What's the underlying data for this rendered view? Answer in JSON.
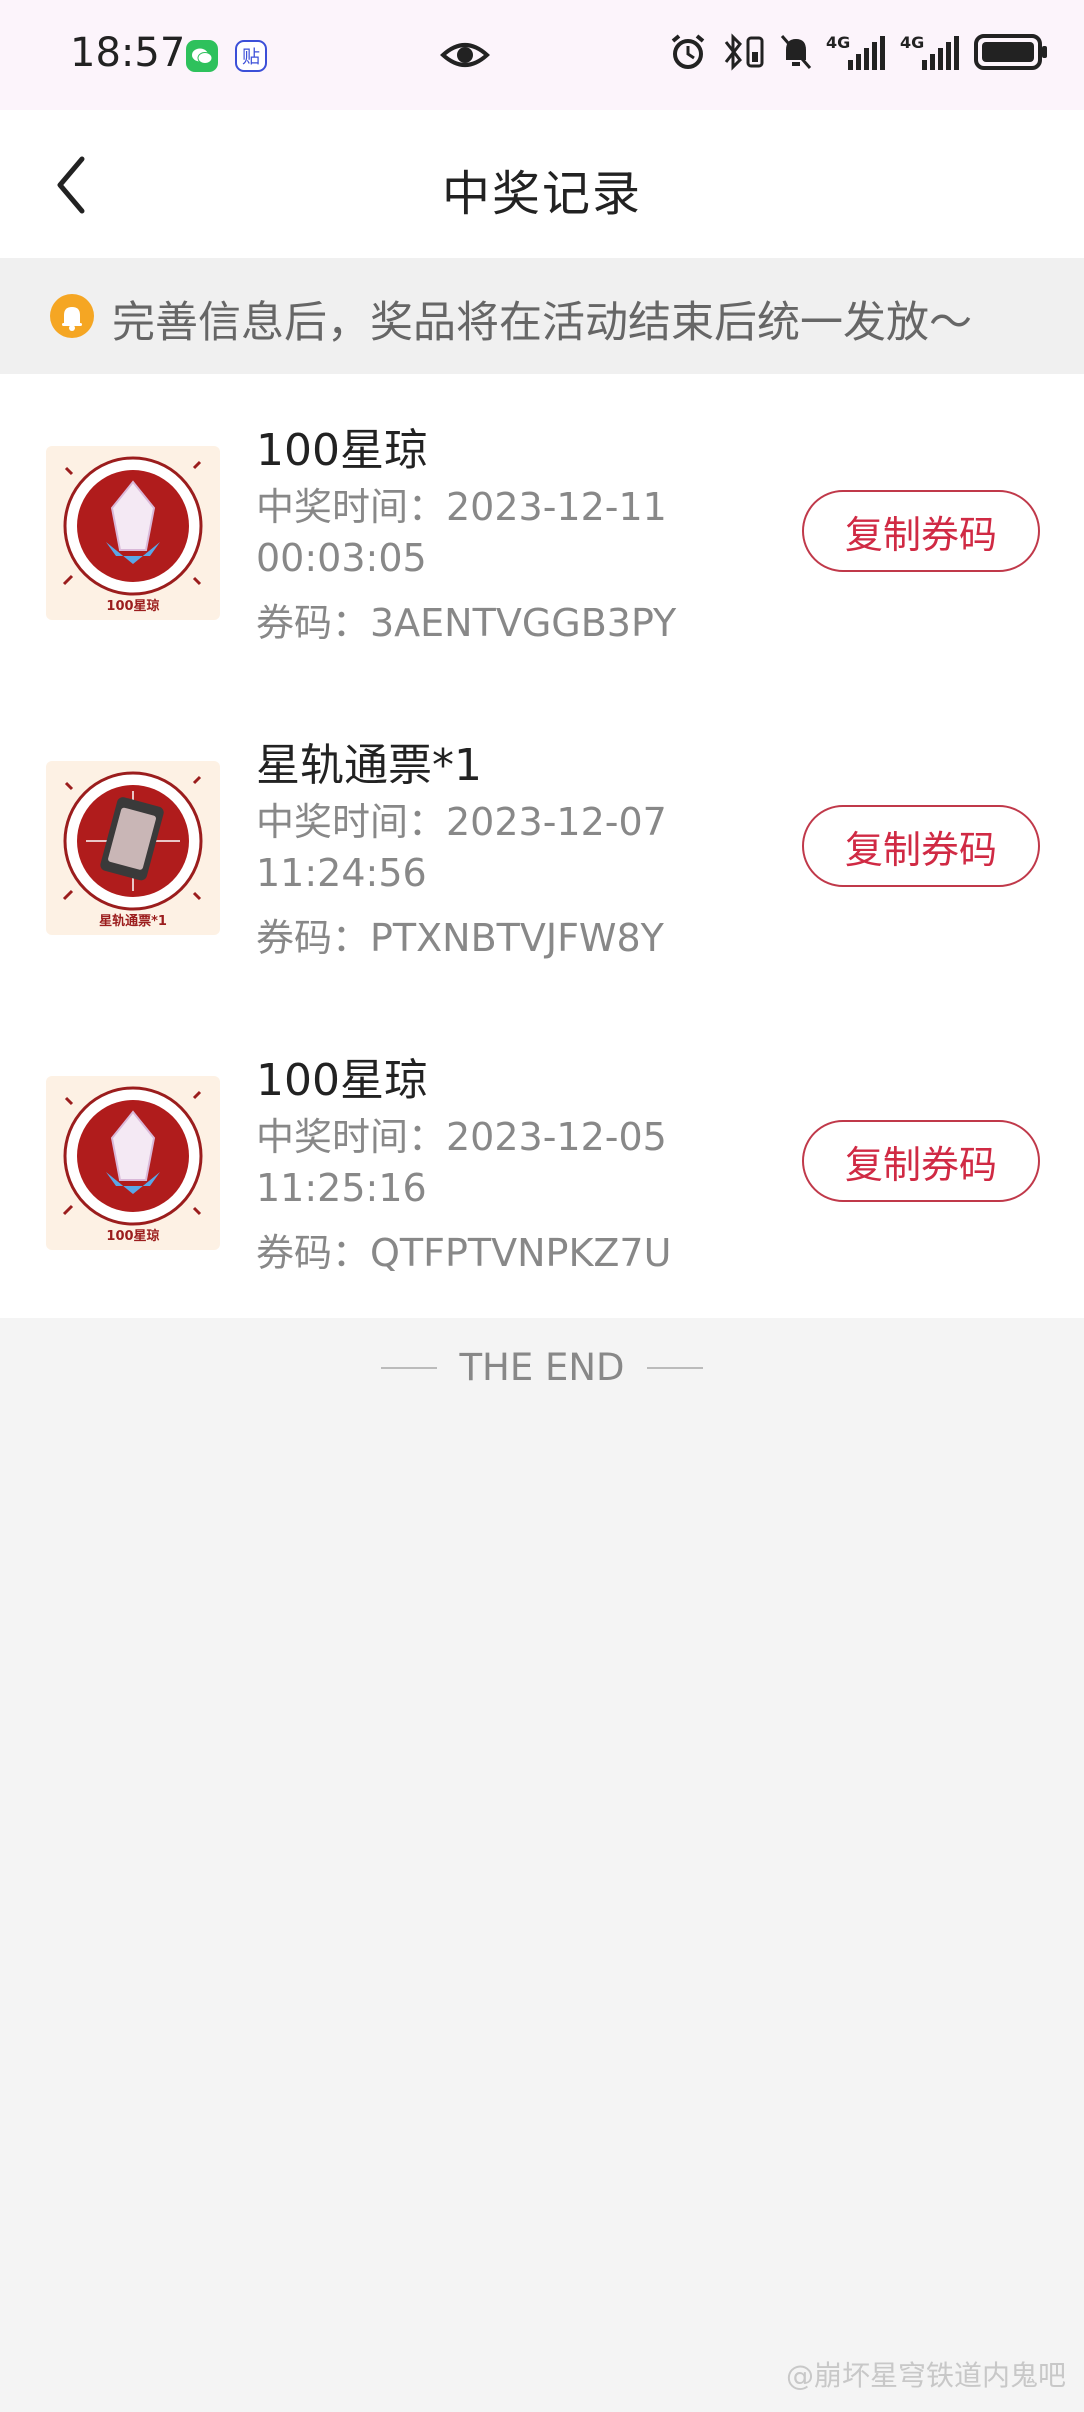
{
  "status_bar": {
    "time": "18:57",
    "icons": [
      "wechat-icon",
      "tieba-icon",
      "eye-icon",
      "alarm-icon",
      "bluetooth-icon",
      "mute-icon",
      "signal-4g-icon",
      "signal-4g-icon",
      "battery-icon"
    ],
    "network_label_1": "4G",
    "network_label_2": "4G",
    "tieba_glyph": "贴"
  },
  "nav": {
    "title": "中奖记录",
    "back_icon": "chevron-left-icon"
  },
  "notice": {
    "text": "完善信息后，奖品将在活动结束后统一发放～",
    "icon": "bell-icon"
  },
  "records": [
    {
      "title": "100星琼",
      "time_text": "中奖时间：2023-12-11 00:03:05",
      "code_text": "券码：3AENTVGGB3PY",
      "thumb_label": "100星琼",
      "button": "复制券码"
    },
    {
      "title": "星轨通票*1",
      "time_text": "中奖时间：2023-12-07 11:24:56",
      "code_text": "券码：PTXNBTVJFW8Y",
      "thumb_label": "星轨通票*1",
      "button": "复制券码"
    },
    {
      "title": "100星琼",
      "time_text": "中奖时间：2023-12-05 11:25:16",
      "code_text": "券码：QTFPTVNPKZ7U",
      "thumb_label": "100星琼",
      "button": "复制券码"
    }
  ],
  "end_text": "THE END",
  "watermark": "@崩坏星穹铁道内鬼吧",
  "colors": {
    "accent_red": "#d02a44",
    "notice_bell": "#f5a623",
    "page_background": "#f4f4f4"
  }
}
